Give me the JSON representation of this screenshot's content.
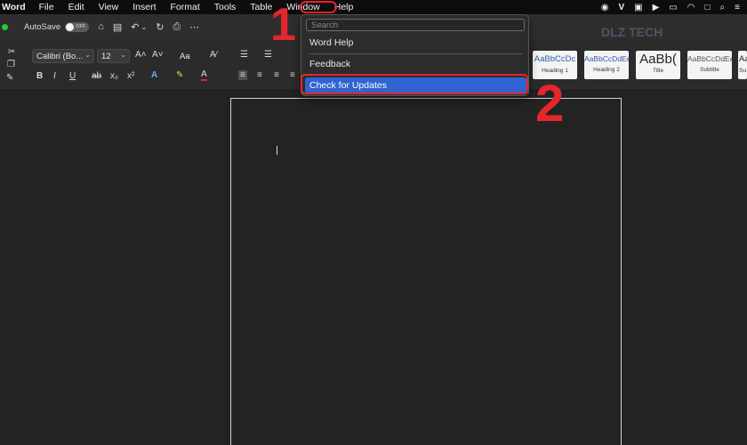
{
  "menubar": {
    "app": "Word",
    "items": [
      "File",
      "Edit",
      "View",
      "Insert",
      "Format",
      "Tools",
      "Table",
      "Window",
      "Help"
    ],
    "status_icons": [
      "chat-icon",
      "v-icon",
      "screen-icon",
      "play-icon",
      "battery-icon",
      "wifi-icon",
      "window-icon",
      "search-icon",
      "control-center-icon"
    ]
  },
  "toolbar": {
    "autosave_label": "AutoSave",
    "toggle_text": "OFF"
  },
  "ribbon": {
    "font_name": "Calibri (Bo...",
    "font_size": "12",
    "styles": [
      {
        "sample": "AaBbCcDc",
        "name": "Heading 1"
      },
      {
        "sample": "AaBbCcDdEe",
        "name": "Heading 2"
      },
      {
        "sample": "AaBb(",
        "name": "Title"
      },
      {
        "sample": "AaBbCcDdEe",
        "name": "Subtitle"
      },
      {
        "sample": "Aa",
        "name": "Su"
      }
    ]
  },
  "help_menu": {
    "search_placeholder": "Search",
    "items": [
      "Word Help",
      "Feedback",
      "Check for Updates"
    ]
  },
  "annotations": {
    "step1": "1",
    "step2": "2"
  },
  "watermark": "DLZ TECH",
  "colors": {
    "accent": "#2f63d0",
    "annotation": "#e5262d"
  }
}
